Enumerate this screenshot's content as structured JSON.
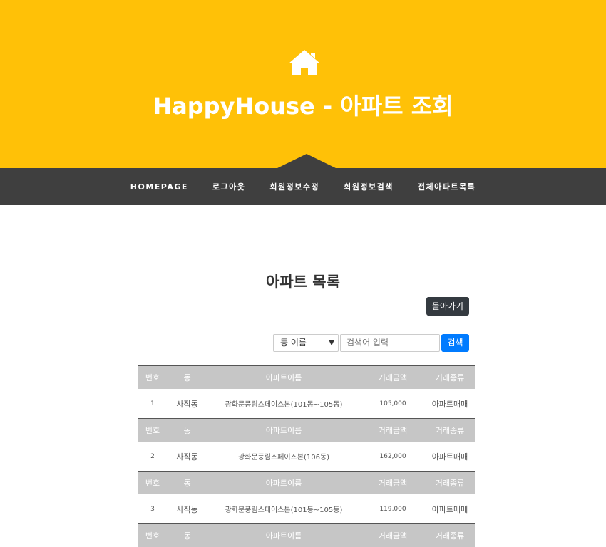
{
  "header": {
    "title": "HappyHouse - 아파트 조회",
    "icon": "home-icon"
  },
  "nav": {
    "items": [
      "HOMEPAGE",
      "로그아웃",
      "회원정보수정",
      "회원정보검색",
      "전체아파트목록"
    ]
  },
  "section": {
    "title": "아파트 목록",
    "back_label": "돌아가기"
  },
  "search": {
    "select_value": "동 이름",
    "input_placeholder": "검색어 입력",
    "button_label": "검색"
  },
  "table": {
    "columns": [
      "번호",
      "동",
      "아파트이름",
      "거래금액",
      "거래종류"
    ],
    "rows": [
      {
        "no": "1",
        "dong": "사직동",
        "name": "광화문풍림스페이스본(101동~105동)",
        "price": "105,000",
        "type": "아파트매매"
      },
      {
        "no": "2",
        "dong": "사직동",
        "name": "광화문풍림스페이스본(106동)",
        "price": "162,000",
        "type": "아파트매매"
      },
      {
        "no": "3",
        "dong": "사직동",
        "name": "광화문풍림스페이스본(101동~105동)",
        "price": "119,000",
        "type": "아파트매매"
      }
    ]
  },
  "colors": {
    "hero_bg": "#ffc107",
    "nav_bg": "#3f3f3f",
    "table_header_bg": "#c6c6c6",
    "search_button": "#007bff",
    "back_button": "#343a40"
  }
}
